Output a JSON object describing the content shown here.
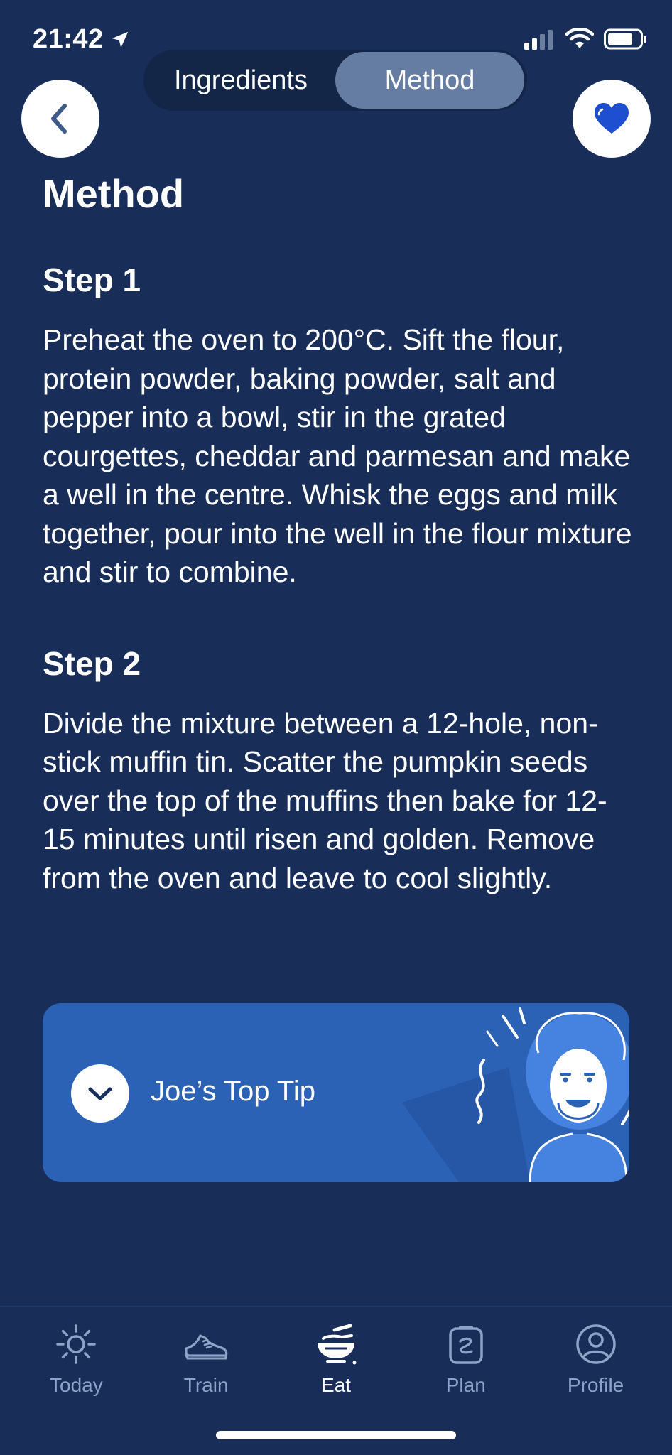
{
  "status_bar": {
    "time": "21:42"
  },
  "segmented": {
    "tab_ingredients": "Ingredients",
    "tab_method": "Method",
    "active": "Method"
  },
  "page": {
    "title": "Method"
  },
  "steps": [
    {
      "title": "Step 1",
      "text": "Preheat the oven to 200°C. Sift the flour, protein powder, baking powder, salt and pepper into a bowl, stir in the grated courgettes, cheddar and parmesan and make a well in the centre. Whisk the eggs and milk together, pour into the well in the flour mixture and stir to combine."
    },
    {
      "title": "Step 2",
      "text": "Divide the mixture between a 12-hole, non-stick muffin tin. Scatter the pumpkin seeds over the top of the muffins then bake for 12-15 minutes until risen and golden. Remove from the oven and leave to cool slightly."
    }
  ],
  "tip": {
    "label": "Joe’s Top Tip"
  },
  "tabs": [
    {
      "label": "Today",
      "icon": "sun-icon"
    },
    {
      "label": "Train",
      "icon": "shoe-icon"
    },
    {
      "label": "Eat",
      "icon": "bowl-icon",
      "active": true
    },
    {
      "label": "Plan",
      "icon": "clipboard-icon"
    },
    {
      "label": "Profile",
      "icon": "profile-icon"
    }
  ],
  "colors": {
    "background": "#182d58",
    "card": "#2c62b5",
    "active_segment": "#667da3",
    "heart": "#1f4fd1",
    "inactive_tab": "#8ea3c6"
  }
}
